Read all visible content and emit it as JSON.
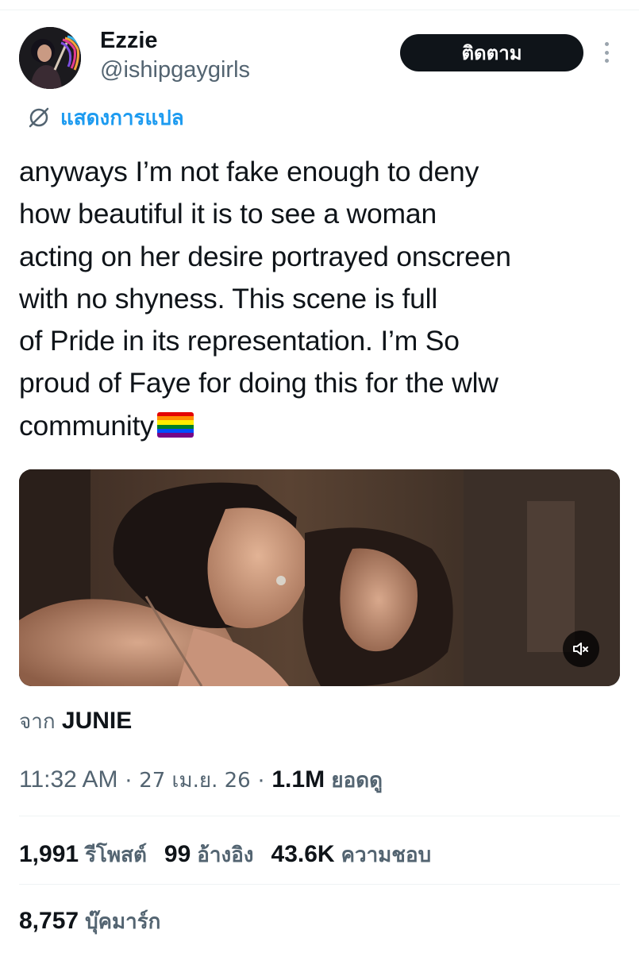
{
  "author": {
    "display_name": "Ezzie",
    "handle": "@ishipgaygirls"
  },
  "header": {
    "follow_label": "ติดตาม",
    "more_icon": "more-vertical-icon"
  },
  "translate": {
    "label": "แสดงการแปล",
    "icon": "globe-slash-icon"
  },
  "tweet": {
    "lines": [
      "anyways I’m not fake enough to deny",
      "how beautiful it is to see a woman",
      "acting on her desire portrayed onscreen",
      "with no shyness. This scene is full",
      "of Pride in its representation. I’m So",
      "proud of Faye for doing this for the wlw",
      "community"
    ],
    "emoji": "rainbow-flag"
  },
  "media": {
    "mute_icon": "volume-muted-icon"
  },
  "source": {
    "prefix": "จาก",
    "name": "JUNIE"
  },
  "meta": {
    "time": "11:32 AM",
    "sep1": " · ",
    "date": "27 เม.ย. 26",
    "sep2": " · ",
    "views": "1.1M",
    "views_label": "ยอดดู"
  },
  "stats": {
    "retweets": "1,991",
    "retweets_label": "รีโพสต์",
    "quotes": "99",
    "quotes_label": "อ้างอิง",
    "likes": "43.6K",
    "likes_label": "ความชอบ",
    "bookmarks": "8,757",
    "bookmarks_label": "บุ๊คมาร์ก"
  },
  "colors": {
    "accent": "#1d9bf0",
    "text": "#0f1419",
    "secondary": "#536471",
    "button_bg": "#0f1419",
    "divider": "#eff3f4"
  }
}
